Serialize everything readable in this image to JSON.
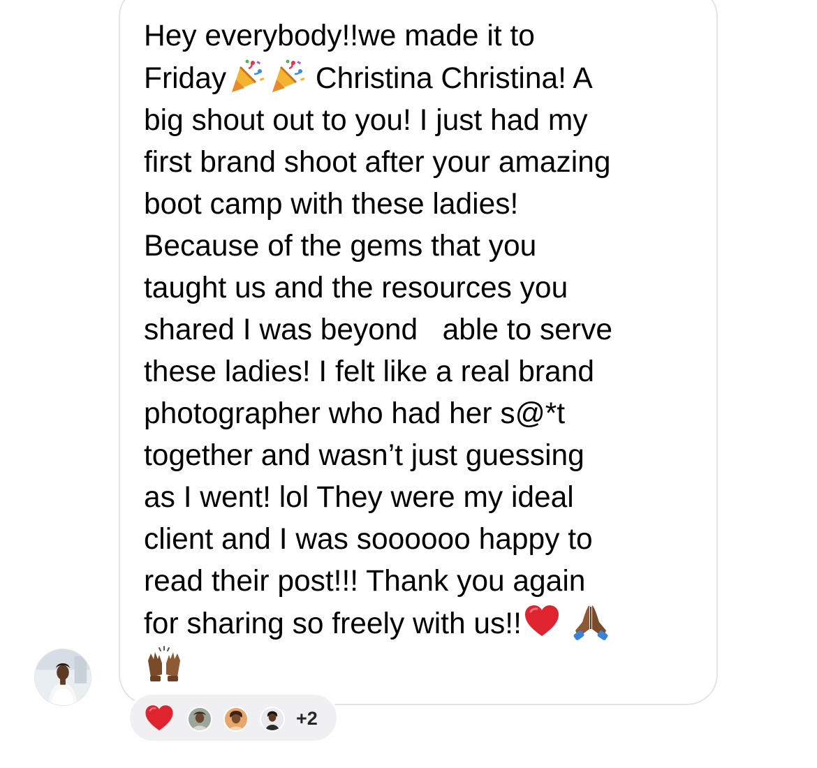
{
  "message": {
    "lines": [
      "Hey everybody!!we made it to",
      "Friday",
      " Christina Christina! A",
      "big shout out to you! I just had my",
      "first brand shoot after your amazing",
      "boot camp with these ladies!",
      "Because of the gems that you",
      "taught us and the resources you",
      "shared I was beyond   able to serve",
      "these ladies! I felt like a real brand",
      "photographer who had her s@*t",
      "together and wasn’t just guessing",
      "as I went! lol They were my ideal",
      "client and I was soooooo happy to",
      "read their post!!! Thank you again",
      "for sharing so freely with us!!"
    ],
    "emojis": {
      "party": "party-popper-icon",
      "heart": "red-heart-icon",
      "pray": "folded-hands-icon",
      "raise": "raising-hands-icon"
    },
    "text_color": "#000000",
    "bubble_border_color": "#e4e4e6"
  },
  "reactions": {
    "emoji": "red-heart-icon",
    "count_label": "+2",
    "background": "#f0f0f2"
  }
}
